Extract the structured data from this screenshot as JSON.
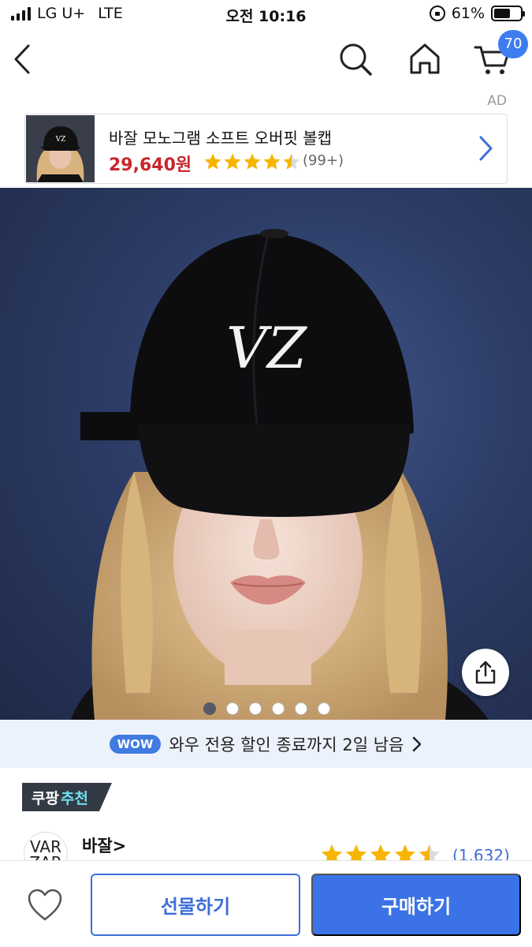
{
  "status_bar": {
    "carrier": "LG U+",
    "network": "LTE",
    "time": "오전 10:16",
    "battery": "61%",
    "battery_level": 0.61
  },
  "header": {
    "cart_count": "70",
    "icons": [
      "back-icon",
      "search-icon",
      "home-icon",
      "cart-icon"
    ]
  },
  "ad": {
    "label": "AD",
    "title": "바잘 모노그램 소프트 오버핏 볼캡",
    "price": "29,640원",
    "rating": 4.5,
    "review_count": "(99+)"
  },
  "hero": {
    "image_count": 6,
    "active_index": 0,
    "logo_text": "VZ"
  },
  "wow_banner": {
    "badge": "WOW",
    "text": "와우 전용 할인 종료까지 2일 남음"
  },
  "recommendation": {
    "label_a": "쿠팡",
    "label_b": "추천"
  },
  "brand": {
    "logo_line1": "VAR",
    "logo_line2": "ZAR",
    "name": "바잘>",
    "rating": 4.5,
    "review_count": "(1,632)"
  },
  "bottom_bar": {
    "gift_label": "선물하기",
    "buy_label": "구매하기"
  },
  "colors": {
    "accent_blue": "#3b73e6",
    "price_red": "#c8262b",
    "star": "#f7b500",
    "badge_blue": "#3d7df0"
  }
}
